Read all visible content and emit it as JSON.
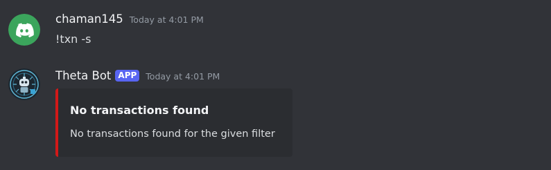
{
  "messages": [
    {
      "author": "chaman145",
      "timestamp": "Today at 4:01 PM",
      "content": "!txn -s",
      "avatar_icon": "discord-logo-icon",
      "avatar_color": "#3ba55c"
    },
    {
      "author": "Theta Bot",
      "badge": "APP",
      "timestamp": "Today at 4:01 PM",
      "avatar_icon": "robot-icon",
      "embed": {
        "title": "No transactions found",
        "description": "No transactions found for the given filter",
        "accent_color": "#d21919"
      }
    }
  ],
  "colors": {
    "background": "#313338",
    "embed_background": "#2b2d31",
    "badge": "#5865f2",
    "timestamp": "#949ba4"
  }
}
